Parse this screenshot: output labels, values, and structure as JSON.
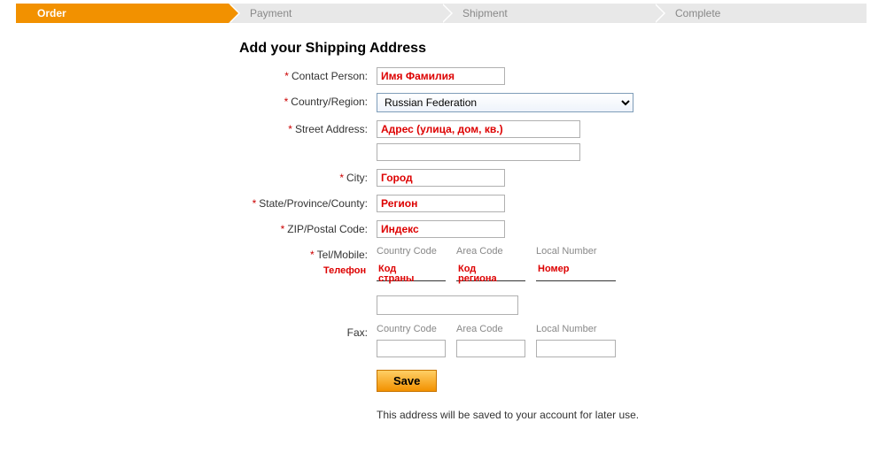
{
  "progress": {
    "steps": [
      "Order",
      "Payment",
      "Shipment",
      "Complete"
    ],
    "activeIndex": 0
  },
  "heading": "Add your Shipping Address",
  "labels": {
    "contact": "Contact Person:",
    "country": "Country/Region:",
    "street": "Street Address:",
    "city": "City:",
    "state": "State/Province/County:",
    "zip": "ZIP/Postal Code:",
    "tel": "Tel/Mobile:",
    "fax": "Fax:"
  },
  "phoneCols": {
    "cc": "Country Code",
    "ac": "Area Code",
    "ln": "Local Number"
  },
  "values": {
    "contact": "Имя Фамилия",
    "country": "Russian Federation",
    "street1": "Адрес (улица, дом, кв.)",
    "street2": "",
    "city": "Город",
    "state": "Регион",
    "zip": "Индекс"
  },
  "annotations": {
    "telLabel": "Телефон",
    "cc": "Код\nстраны",
    "ac": "Код\nрегиона",
    "ln": "Номер"
  },
  "buttons": {
    "save": "Save"
  },
  "note": "This address will be saved to your account for later use."
}
